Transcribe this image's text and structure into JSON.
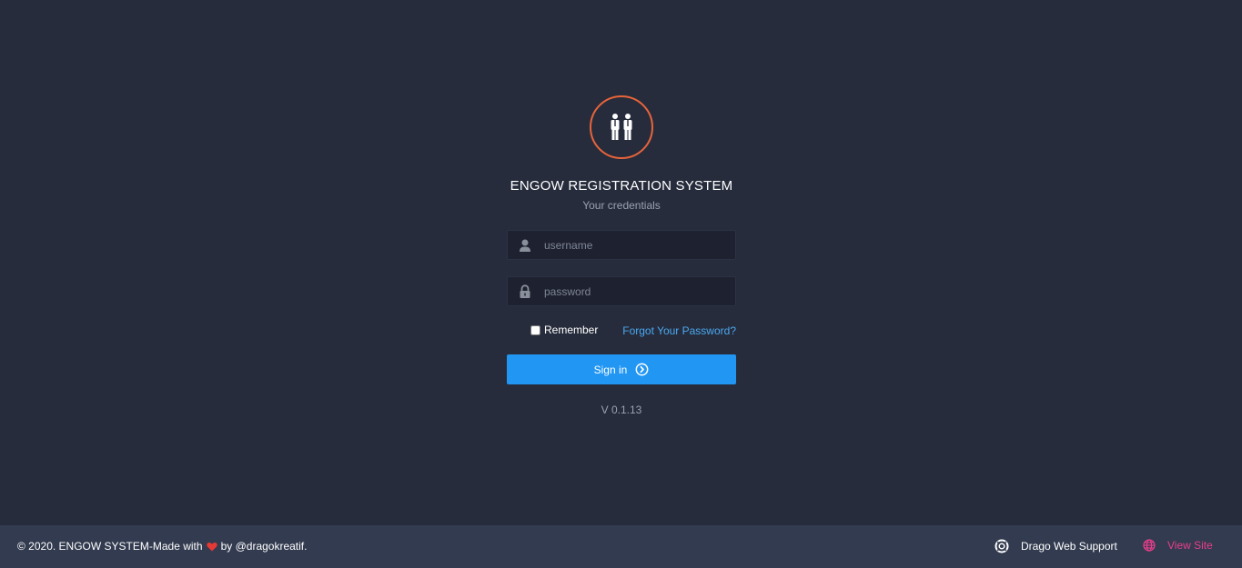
{
  "login": {
    "title": "ENGOW REGISTRATION SYSTEM",
    "subtitle": "Your credentials",
    "username_placeholder": "username",
    "password_placeholder": "password",
    "remember_label": "Remember",
    "remember_checked": false,
    "forgot_label": "Forgot Your Password?",
    "signin_label": "Sign in",
    "version": "V 0.1.13",
    "logo_icon": "people-icon",
    "accent_color": "#e8643a",
    "button_color": "#2196f3"
  },
  "footer": {
    "copyright_prefix": "© 2020. ENGOW SYSTEM-Made with",
    "copyright_suffix": "by @dragokreatif.",
    "support_label": "Drago Web Support",
    "support_icon": "lifebuoy-icon",
    "viewsite_label": "View Site",
    "viewsite_icon": "globe-icon",
    "heart_color": "#e53935",
    "viewsite_color": "#e83e8c"
  }
}
